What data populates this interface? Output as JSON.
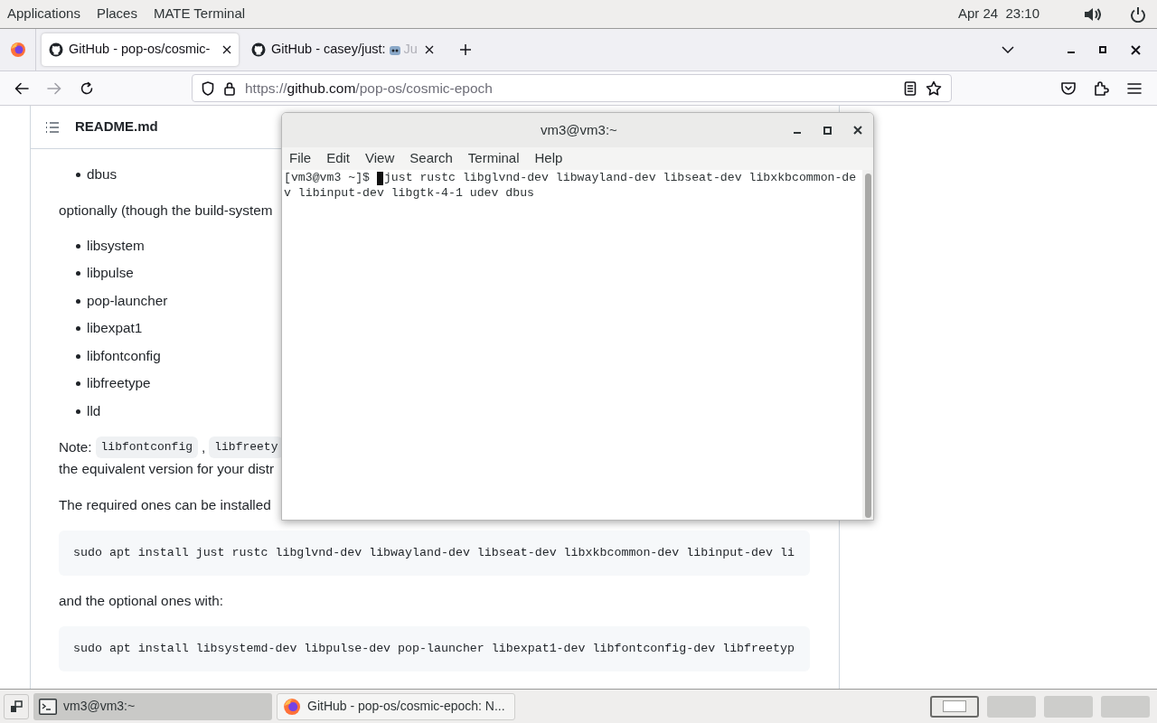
{
  "top_panel": {
    "menus": [
      "Applications",
      "Places",
      "MATE Terminal"
    ],
    "clock": "Apr 24  23:10"
  },
  "browser": {
    "tabs": [
      {
        "title": "GitHub - pop-os/cosmic-",
        "selected": true
      },
      {
        "title": "GitHub - casey/just:",
        "title_tail": "Ju",
        "selected": false
      }
    ],
    "url": {
      "scheme": "https://",
      "host": "github.com",
      "path": "/pop-os/cosmic-epoch"
    }
  },
  "readme": {
    "title": "README.md",
    "blocks": [
      {
        "kind": "list",
        "items": [
          "dbus"
        ]
      },
      {
        "kind": "paragraph",
        "text": "optionally (though the build-system"
      },
      {
        "kind": "list",
        "items": [
          "libsystem",
          "libpulse",
          "pop-launcher",
          "libexpat1",
          "libfontconfig",
          "libfreetype",
          "lld"
        ]
      },
      {
        "kind": "note",
        "label": "Note:",
        "codes": [
          "libfontconfig",
          "libfreety"
        ],
        "separator": ",",
        "continuation": "the equivalent version for your distr"
      },
      {
        "kind": "paragraph",
        "text": "The required ones can be installed"
      },
      {
        "kind": "code",
        "text": "sudo apt install just rustc libglvnd-dev libwayland-dev libseat-dev libxkbcommon-dev libinput-dev li"
      },
      {
        "kind": "paragraph",
        "text": "and the optional ones with:"
      },
      {
        "kind": "code",
        "text": "sudo apt install libsystemd-dev libpulse-dev pop-launcher libexpat1-dev libfontconfig-dev libfreetyp"
      }
    ]
  },
  "terminal": {
    "title": "vm3@vm3:~",
    "menus": [
      "File",
      "Edit",
      "View",
      "Search",
      "Terminal",
      "Help"
    ],
    "prompt": "[vm3@vm3 ~]$",
    "lines": [
      "just rustc libglvnd-dev libwayland-dev libseat-dev libxkbcommon-de",
      "v libinput-dev libgtk-4-1 udev dbus"
    ]
  },
  "taskbar": {
    "tasks": [
      {
        "kind": "terminal",
        "title": "vm3@vm3:~",
        "selected": true
      },
      {
        "kind": "firefox",
        "title": "GitHub - pop-os/cosmic-epoch: N...",
        "selected": false
      }
    ],
    "workspaces": [
      {
        "selected": true
      },
      {
        "selected": false
      },
      {
        "selected": false
      },
      {
        "selected": false
      }
    ]
  }
}
